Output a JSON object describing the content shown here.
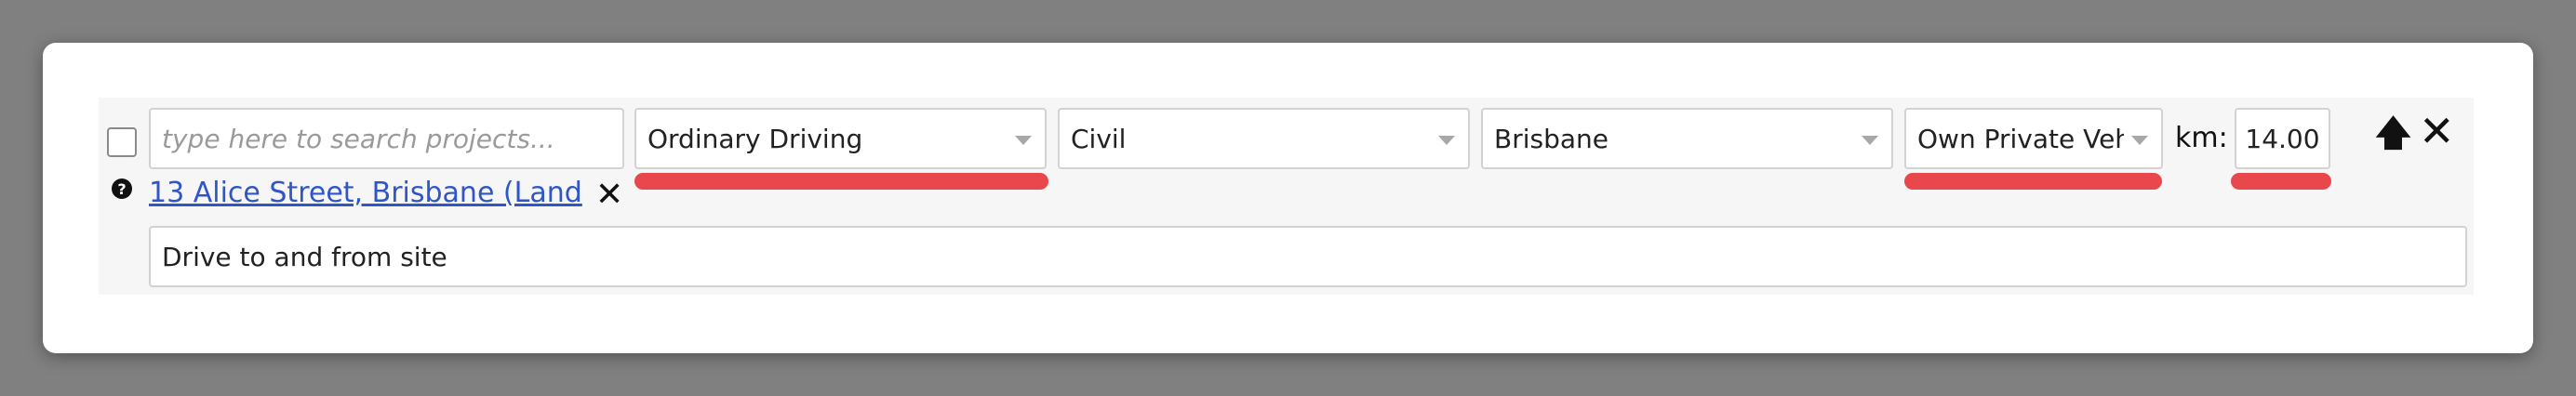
{
  "entry": {
    "project_search": {
      "placeholder": "type here to search projects..."
    },
    "mileage_type": {
      "selected": "Ordinary Driving"
    },
    "department": {
      "selected": "Civil"
    },
    "location": {
      "selected": "Brisbane"
    },
    "vehicle": {
      "selected": "Own Private Vehi"
    },
    "km": {
      "label": "km:",
      "value": "14.00"
    },
    "project_link": "13 Alice Street, Brisbane (Land",
    "description": "Drive to and from site"
  },
  "icons": {
    "help": "question-circle-icon",
    "move_up": "arrow-up-icon",
    "remove_row": "close-icon",
    "remove_project": "close-icon"
  },
  "colors": {
    "validation_underline": "#e8474c",
    "link": "#2f55c8",
    "backdrop": "#808080"
  }
}
